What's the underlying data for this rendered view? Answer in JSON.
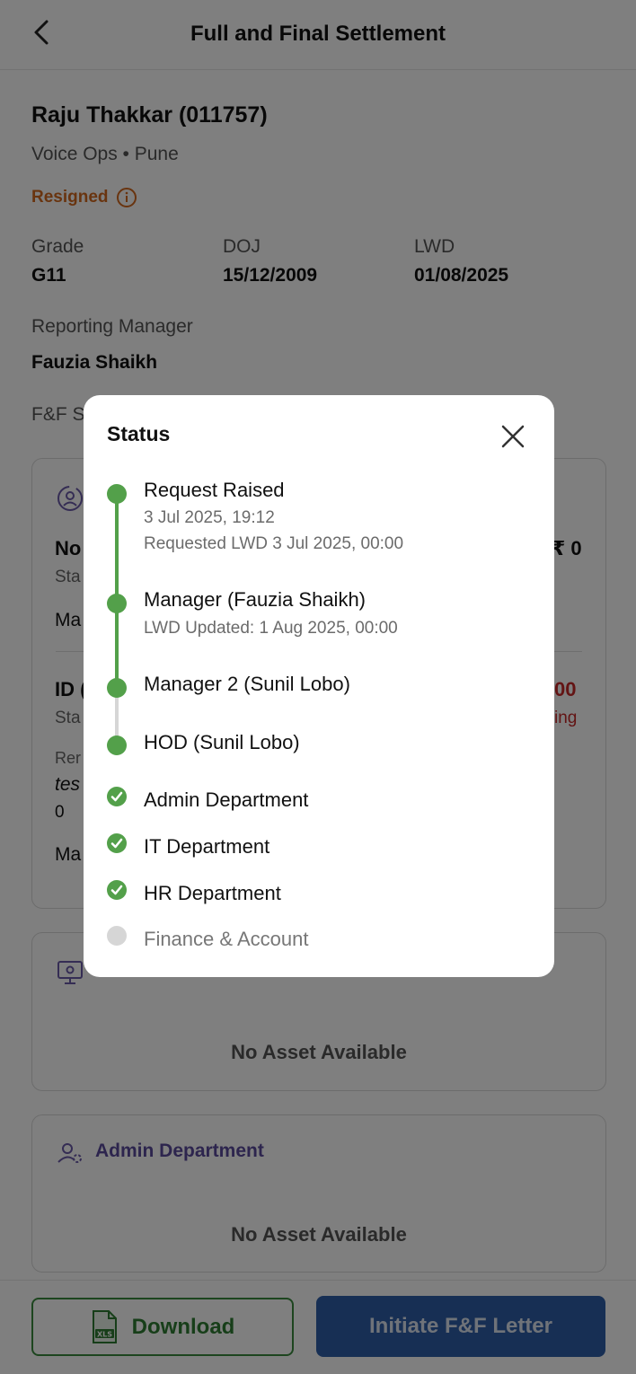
{
  "header": {
    "title": "Full and Final Settlement",
    "back_icon": "chevron-left-icon"
  },
  "employee": {
    "name": "Raju Thakkar (011757)",
    "subtitle": "Voice Ops • Pune",
    "status": "Resigned",
    "status_color": "#d2691e",
    "grade_label": "Grade",
    "grade_value": "G11",
    "doj_label": "DOJ",
    "doj_value": "15/12/2009",
    "lwd_label": "LWD",
    "lwd_value": "01/08/2025",
    "manager_label": "Reporting Manager",
    "manager_value": "Fauzia Shaikh",
    "ff_label": "F&F S"
  },
  "background_fragments": {
    "no": "No",
    "sta1": "Sta",
    "ma1": "Ma",
    "amount1": "₹ 0",
    "id": "ID (",
    "sta2": "Sta",
    "amount2": "00",
    "ing": "ing",
    "rer": "Rer",
    "tes": "tes",
    "zero": "0",
    "ma2": "Ma"
  },
  "cards": [
    {
      "title": "",
      "empty_text": "No Asset Available"
    },
    {
      "title": "Admin Department",
      "empty_text": "No Asset Available"
    }
  ],
  "buttons": {
    "download": "Download",
    "initiate": "Initiate F&F Letter"
  },
  "modal": {
    "title": "Status",
    "steps": [
      {
        "title": "Request Raised",
        "lines": [
          "3 Jul 2025, 19:12",
          "Requested LWD 3 Jul 2025, 00:00"
        ],
        "state": "done-dot"
      },
      {
        "title": "Manager (Fauzia Shaikh)",
        "lines": [
          "LWD Updated: 1 Aug 2025, 00:00"
        ],
        "state": "done-dot"
      },
      {
        "title": "Manager 2 (Sunil Lobo)",
        "lines": [],
        "state": "done-dot"
      },
      {
        "title": "HOD (Sunil Lobo)",
        "lines": [],
        "state": "done-dot"
      },
      {
        "title": "Admin Department",
        "lines": [],
        "state": "checked"
      },
      {
        "title": "IT Department",
        "lines": [],
        "state": "checked"
      },
      {
        "title": "HR Department",
        "lines": [],
        "state": "checked"
      },
      {
        "title": "Finance & Account",
        "lines": [],
        "state": "pending"
      }
    ]
  },
  "colors": {
    "green": "#53a04a",
    "primary_blue": "#2f5ea8",
    "grey": "#d6d6d6",
    "overlay": "rgba(0,0,0,0.5)"
  }
}
